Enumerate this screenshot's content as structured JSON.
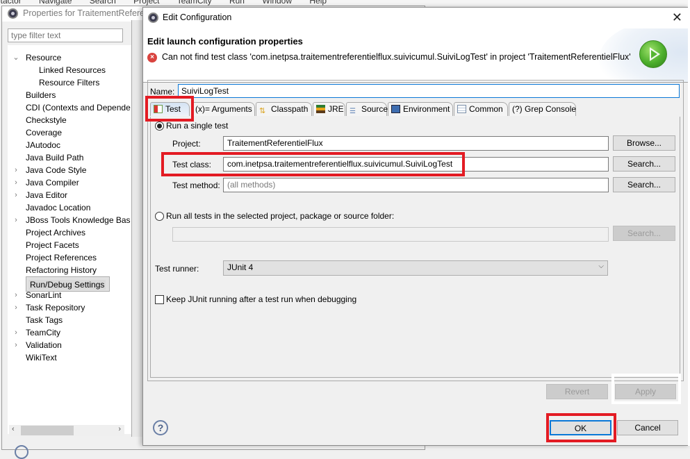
{
  "background_menu": [
    "etactor",
    "Navigate",
    "Search",
    "Project",
    "TeamCity",
    "Run",
    "Window",
    "Help"
  ],
  "properties_window": {
    "title": "Properties for TraitementReferent",
    "filter_placeholder": "type filter text",
    "tree": [
      {
        "label": "Resource",
        "expanded": true,
        "indent": 0
      },
      {
        "label": "Linked Resources",
        "indent": 1
      },
      {
        "label": "Resource Filters",
        "indent": 1
      },
      {
        "label": "Builders",
        "indent": 0
      },
      {
        "label": "CDI (Contexts and Depende",
        "indent": 0
      },
      {
        "label": "Checkstyle",
        "indent": 0
      },
      {
        "label": "Coverage",
        "indent": 0
      },
      {
        "label": "JAutodoc",
        "indent": 0
      },
      {
        "label": "Java Build Path",
        "indent": 0
      },
      {
        "label": "Java Code Style",
        "collapsed": true,
        "indent": 0
      },
      {
        "label": "Java Compiler",
        "collapsed": true,
        "indent": 0
      },
      {
        "label": "Java Editor",
        "collapsed": true,
        "indent": 0
      },
      {
        "label": "Javadoc Location",
        "indent": 0
      },
      {
        "label": "JBoss Tools Knowledge Bas",
        "collapsed": true,
        "indent": 0
      },
      {
        "label": "Project Archives",
        "indent": 0
      },
      {
        "label": "Project Facets",
        "indent": 0
      },
      {
        "label": "Project References",
        "indent": 0
      },
      {
        "label": "Refactoring History",
        "indent": 0
      },
      {
        "label": "Run/Debug Settings",
        "selected": true,
        "indent": 0
      },
      {
        "label": "SonarLint",
        "collapsed": true,
        "indent": 0
      },
      {
        "label": "Task Repository",
        "collapsed": true,
        "indent": 0
      },
      {
        "label": "Task Tags",
        "indent": 0
      },
      {
        "label": "TeamCity",
        "collapsed": true,
        "indent": 0
      },
      {
        "label": "Validation",
        "collapsed": true,
        "indent": 0
      },
      {
        "label": "WikiText",
        "indent": 0
      }
    ]
  },
  "dialog": {
    "title": "Edit Configuration",
    "close_glyph": "✕",
    "banner_title": "Edit launch configuration properties",
    "error_message": "Can not find test class 'com.inetpsa.traitementreferentielflux.suivicumul.SuiviLogTest' in project 'TraitementReferentielFlux'",
    "name_label": "Name:",
    "name_value": "SuiviLogTest",
    "tabs": [
      {
        "label": "Test",
        "icon": "junit-test-icon",
        "active": true
      },
      {
        "label": "(x)= Arguments",
        "icon": ""
      },
      {
        "label": "Classpath",
        "icon": "classpath-icon"
      },
      {
        "label": "JRE",
        "icon": "jre-icon"
      },
      {
        "label": "Source",
        "icon": "source-icon"
      },
      {
        "label": "Environment",
        "icon": "environment-icon"
      },
      {
        "label": "Common",
        "icon": "common-icon"
      },
      {
        "label": "(?) Grep Console",
        "icon": ""
      }
    ],
    "run_single": {
      "label": "Run a single test",
      "selected": true
    },
    "project": {
      "label": "Project:",
      "value": "TraitementReferentielFlux",
      "button": "Browse..."
    },
    "test_class": {
      "label": "Test class:",
      "value": "com.inetpsa.traitementreferentielflux.suivicumul.SuiviLogTest",
      "button": "Search..."
    },
    "test_method": {
      "label": "Test method:",
      "placeholder": "(all methods)",
      "button": "Search..."
    },
    "run_all": {
      "label": "Run all tests in the selected project, package or source folder:",
      "selected": false,
      "value": "",
      "button": "Search..."
    },
    "test_runner": {
      "label": "Test runner:",
      "value": "JUnit 4"
    },
    "keep_running": {
      "label": "Keep JUnit running after a test run when debugging",
      "checked": false
    },
    "revert_label": "Revert",
    "apply_label": "Apply",
    "ok_label": "OK",
    "cancel_label": "Cancel",
    "help_glyph": "?"
  },
  "colors": {
    "highlight_red": "#e31b23",
    "focus_blue": "#0a78d7",
    "error_red": "#d9433f",
    "run_green": "#4cae2c"
  }
}
